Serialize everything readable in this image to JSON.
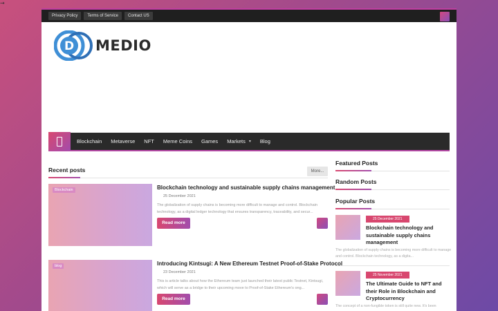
{
  "corner_arrow": "→",
  "topbar": {
    "links": [
      "Privacy Policy",
      "Terms of Service",
      "Contact US"
    ]
  },
  "logo": {
    "mark": "D",
    "text": "MEDIO"
  },
  "nav": {
    "items": [
      "Blockchain",
      "Metaverse",
      "NFT",
      "Meme Coins",
      "Games",
      "Markets",
      "Blog"
    ],
    "markets_caret": "▾"
  },
  "recent": {
    "title": "Recent posts",
    "more_label": "More...",
    "posts": [
      {
        "tag": "Blockchain",
        "title": "Blockchain technology and sustainable supply chains management",
        "date": "25 December 2021",
        "excerpt": "The globalization of supply chains is becoming more difficult to manage and control. Blockchain technology, as a digital ledger technology that ensures transparency, traceability, and secur...",
        "read_more": "Read more"
      },
      {
        "tag": "blog",
        "title": "Introducing Kintsugi: A New Ethereum Testnet Proof-of-Stake Protocol",
        "date": "23 December 2021",
        "excerpt": "This is article talks about how the Ethereum team just launched their latest public Testnet, Kintsugi, which will serve as a bridge to their upcoming move to Proof-of-Stake Ethereum's ong...",
        "read_more": "Read more"
      }
    ]
  },
  "sidebar": {
    "featured_title": "Featured Posts",
    "random_title": "Random Posts",
    "popular_title": "Popular Posts",
    "popular": [
      {
        "date": "25 December 2021",
        "title": "Blockchain technology and sustainable supply chains management",
        "excerpt": "The globalization of supply chains is becoming more difficult to manage and control. Blockchain technology, as a digita..."
      },
      {
        "date": "25 November 2021",
        "title": "The Ultimate Guide to NFT and their Role in Blockchain and Cryptocurrency",
        "excerpt": "The concept of a non-fungible token is still quite new. It's been"
      }
    ]
  }
}
